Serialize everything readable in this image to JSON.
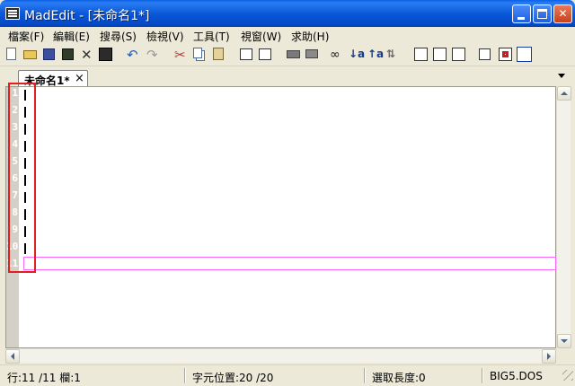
{
  "window": {
    "title": "MadEdit - [未命名1*]"
  },
  "menu": {
    "items": [
      "檔案(F)",
      "編輯(E)",
      "搜尋(S)",
      "檢視(V)",
      "工具(T)",
      "視窗(W)",
      "求助(H)"
    ]
  },
  "tabs": [
    {
      "label": "未命名1*",
      "close": "×"
    }
  ],
  "editor": {
    "line_numbers": [
      "1",
      "2",
      "3",
      "4",
      "5",
      "6",
      "7",
      "8",
      "9",
      "10",
      "11"
    ],
    "current_line": "11"
  },
  "status": {
    "position": "行:11 /11 欄:1",
    "char_pos": "字元位置:20 /20",
    "selection": "選取長度:0",
    "encoding": "BIG5.DOS"
  },
  "colors": {
    "title_bar": "#0a58d8",
    "current_line_border": "#ff66ff",
    "annotation": "#e02020"
  }
}
